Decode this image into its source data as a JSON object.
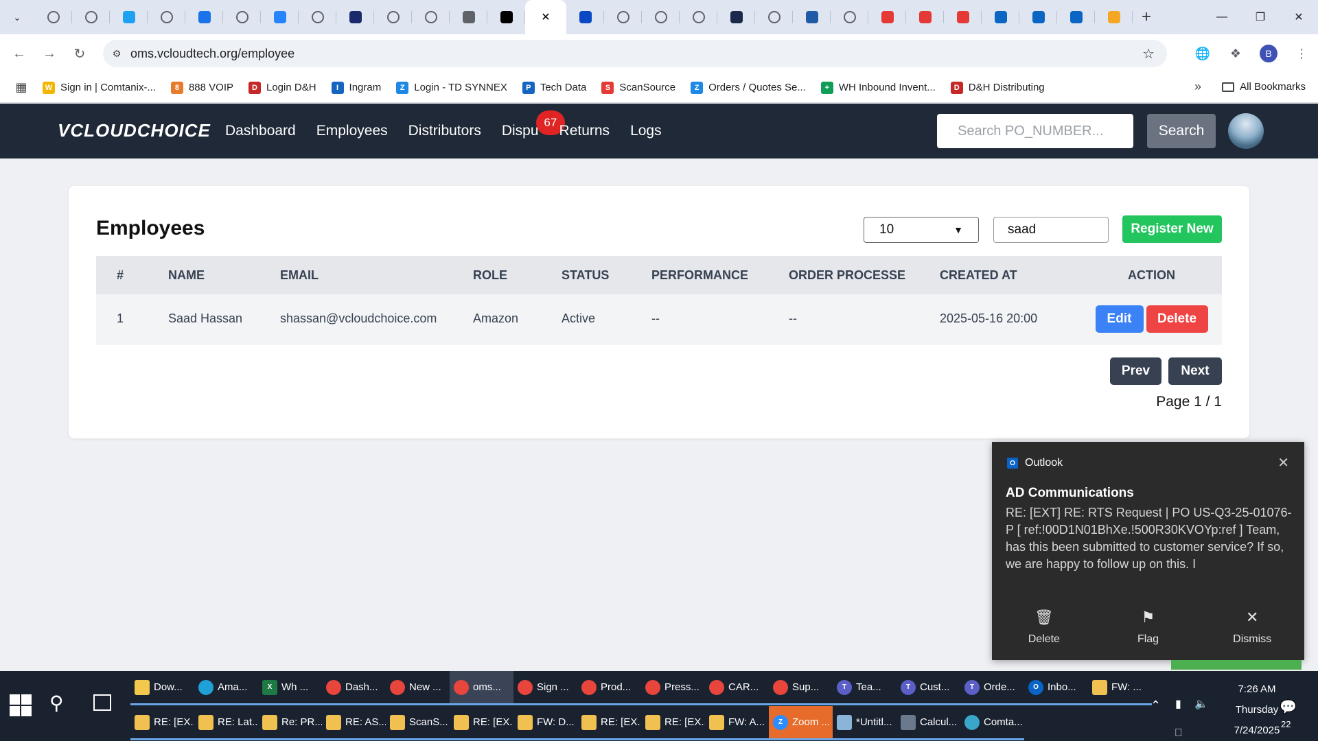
{
  "browser": {
    "tabs": [
      {
        "icon": "globe-icon",
        "color": "#5f6368"
      },
      {
        "icon": "globe-icon",
        "color": "#5f6368"
      },
      {
        "icon": "logi-icon",
        "color": "#1ea1f2"
      },
      {
        "icon": "globe-icon",
        "color": "#5f6368"
      },
      {
        "icon": "chevron-app-icon",
        "color": "#1a73e8"
      },
      {
        "icon": "globe-icon",
        "color": "#5f6368"
      },
      {
        "icon": "jira-icon",
        "color": "#2684ff"
      },
      {
        "icon": "globe-icon",
        "color": "#5f6368"
      },
      {
        "icon": "app-square-icon",
        "color": "#1b2a6b"
      },
      {
        "icon": "globe-icon",
        "color": "#5f6368"
      },
      {
        "icon": "globe-icon",
        "color": "#5f6368"
      },
      {
        "icon": "search-app-icon",
        "color": "#5f6368"
      },
      {
        "icon": "vercel-icon",
        "color": "#000000"
      },
      {
        "icon": "close-icon",
        "color": "#000000"
      },
      {
        "icon": "u-app-icon",
        "color": "#0b48c6"
      },
      {
        "icon": "globe-icon",
        "color": "#5f6368"
      },
      {
        "icon": "globe-icon",
        "color": "#5f6368"
      },
      {
        "icon": "globe-icon",
        "color": "#5f6368"
      },
      {
        "icon": "check-app-icon",
        "color": "#1b2a4a"
      },
      {
        "icon": "globe-icon",
        "color": "#5f6368"
      },
      {
        "icon": "etn-icon",
        "color": "#1f5aa6"
      },
      {
        "icon": "globe-icon",
        "color": "#5f6368"
      },
      {
        "icon": "shield-red-icon",
        "color": "#e53935"
      },
      {
        "icon": "shield-red-icon",
        "color": "#e53935"
      },
      {
        "icon": "shield-red-icon",
        "color": "#e53935"
      },
      {
        "icon": "linkedin-icon",
        "color": "#0a66c2"
      },
      {
        "icon": "linkedin-icon",
        "color": "#0a66c2"
      },
      {
        "icon": "linkedin-icon",
        "color": "#0a66c2"
      },
      {
        "icon": "v-app-icon",
        "color": "#f5a623"
      }
    ],
    "url": "oms.vcloudtech.org/employee",
    "profile_initial": "B",
    "bookmarks": [
      {
        "label": "Sign in | Comtanix-...",
        "icon": "w-bookmark-icon",
        "color": "#f2b705",
        "glyph": "W"
      },
      {
        "label": "888 VOIP",
        "icon": "voip-bookmark-icon",
        "color": "#e57c2b",
        "glyph": "8"
      },
      {
        "label": "Login D&H",
        "icon": "dh-bookmark-icon",
        "color": "#c62828",
        "glyph": "D"
      },
      {
        "label": "Ingram",
        "icon": "ingram-bookmark-icon",
        "color": "#1565c0",
        "glyph": "I"
      },
      {
        "label": "Login - TD SYNNEX",
        "icon": "synnex-bookmark-icon",
        "color": "#1e88e5",
        "glyph": "Z"
      },
      {
        "label": "Tech Data",
        "icon": "techdata-bookmark-icon",
        "color": "#1565c0",
        "glyph": "P"
      },
      {
        "label": "ScanSource",
        "icon": "scansource-bookmark-icon",
        "color": "#e53935",
        "glyph": "S"
      },
      {
        "label": "Orders / Quotes Se...",
        "icon": "orders-bookmark-icon",
        "color": "#1e88e5",
        "glyph": "Z"
      },
      {
        "label": "WH Inbound Invent...",
        "icon": "sheets-bookmark-icon",
        "color": "#0f9d58",
        "glyph": "+"
      },
      {
        "label": "D&H Distributing",
        "icon": "dh2-bookmark-icon",
        "color": "#c62828",
        "glyph": "D"
      }
    ],
    "all_bookmarks": "All Bookmarks"
  },
  "app": {
    "logo": "VCLOUDCHOICE",
    "nav": [
      "Dashboard",
      "Employees",
      "Distributors",
      "Dispu",
      "Returns",
      "Logs"
    ],
    "disputes_badge": "67",
    "search_placeholder": "Search PO_NUMBER...",
    "search_button": "Search"
  },
  "page": {
    "title": "Employees",
    "page_size": "10",
    "filter_value": "saad",
    "register_button": "Register New",
    "columns": [
      "#",
      "NAME",
      "EMAIL",
      "ROLE",
      "STATUS",
      "PERFORMANCE",
      "ORDER PROCESSE",
      "CREATED AT",
      "ACTION"
    ],
    "rows": [
      {
        "num": "1",
        "name": "Saad Hassan",
        "email": "shassan@vcloudchoice.com",
        "role": "Amazon",
        "status": "Active",
        "performance": "--",
        "orders": "--",
        "created": "2025-05-16 20:00",
        "edit": "Edit",
        "delete": "Delete"
      }
    ],
    "prev": "Prev",
    "next": "Next",
    "page_info": "Page 1 / 1"
  },
  "notification": {
    "app": "Outlook",
    "sender": "AD Communications",
    "body": "RE: [EXT] RE: RTS Request | PO US-Q3-25-01076-P [ ref:!00D1N01BhXe.!500R30KVOYp:ref ] Team, has this been submitted to customer service?  If so, we are happy to follow up on this.  I",
    "actions": [
      "Delete",
      "Flag",
      "Dismiss"
    ]
  },
  "taskbar": {
    "row1": [
      {
        "label": "Dow...",
        "icon": "file-explorer-icon",
        "color": "#f2c94c",
        "glyph": ""
      },
      {
        "label": "Ama...",
        "icon": "edge-icon",
        "color": "#1fa0d6",
        "glyph": ""
      },
      {
        "label": "Wh ...",
        "icon": "excel-icon",
        "color": "#1d7a45",
        "glyph": "X"
      },
      {
        "label": "Dash...",
        "icon": "chrome-icon",
        "color": "#e8453c",
        "glyph": ""
      },
      {
        "label": "New ...",
        "icon": "chrome-icon",
        "color": "#e8453c",
        "glyph": ""
      },
      {
        "label": "oms...",
        "icon": "chrome-icon",
        "color": "#e8453c",
        "glyph": ""
      },
      {
        "label": "Sign ...",
        "icon": "chrome-icon",
        "color": "#e8453c",
        "glyph": ""
      },
      {
        "label": "Prod...",
        "icon": "chrome-icon",
        "color": "#e8453c",
        "glyph": ""
      },
      {
        "label": "Press...",
        "icon": "chrome-icon",
        "color": "#e8453c",
        "glyph": ""
      },
      {
        "label": "CAR...",
        "icon": "chrome-icon",
        "color": "#e8453c",
        "glyph": ""
      },
      {
        "label": "Sup...",
        "icon": "chrome-icon",
        "color": "#e8453c",
        "glyph": ""
      },
      {
        "label": "Tea...",
        "icon": "teams-icon",
        "color": "#5b5fc7",
        "glyph": "T"
      },
      {
        "label": "Cust...",
        "icon": "teams-icon",
        "color": "#5b5fc7",
        "glyph": "T"
      },
      {
        "label": "Orde...",
        "icon": "teams-icon",
        "color": "#5b5fc7",
        "glyph": "T"
      },
      {
        "label": "Inbo...",
        "icon": "outlook-icon",
        "color": "#0a64c8",
        "glyph": "O"
      },
      {
        "label": "FW: ...",
        "icon": "mail-icon",
        "color": "#f0c050",
        "glyph": ""
      }
    ],
    "row2": [
      {
        "label": "RE: [EX...",
        "icon": "mail-icon",
        "color": "#f0c050",
        "glyph": ""
      },
      {
        "label": "RE: Lat...",
        "icon": "mail-icon",
        "color": "#f0c050",
        "glyph": ""
      },
      {
        "label": "Re: PR...",
        "icon": "mail-icon",
        "color": "#f0c050",
        "glyph": ""
      },
      {
        "label": "RE: AS...",
        "icon": "mail-icon",
        "color": "#f0c050",
        "glyph": ""
      },
      {
        "label": "ScanS...",
        "icon": "mail-icon",
        "color": "#f0c050",
        "glyph": ""
      },
      {
        "label": "RE: [EX...",
        "icon": "mail-icon",
        "color": "#f0c050",
        "glyph": ""
      },
      {
        "label": "FW: D...",
        "icon": "mail-icon",
        "color": "#f0c050",
        "glyph": ""
      },
      {
        "label": "RE: [EX...",
        "icon": "mail-icon",
        "color": "#f0c050",
        "glyph": ""
      },
      {
        "label": "RE: [EX...",
        "icon": "mail-icon",
        "color": "#f0c050",
        "glyph": ""
      },
      {
        "label": "FW: A...",
        "icon": "mail-icon",
        "color": "#f0c050",
        "glyph": ""
      },
      {
        "label": "Zoom ...",
        "icon": "zoom-icon",
        "color": "#2d8cff",
        "glyph": "Z"
      },
      {
        "label": "*Untitl...",
        "icon": "notepad-icon",
        "color": "#8ab4d8",
        "glyph": ""
      },
      {
        "label": "Calcul...",
        "icon": "calculator-icon",
        "color": "#6a7a8c",
        "glyph": ""
      },
      {
        "label": "Comta...",
        "icon": "app-diamond-icon",
        "color": "#3aa6c9",
        "glyph": ""
      }
    ],
    "time": "7:26 AM",
    "day": "Thursday",
    "date": "7/24/2025",
    "notif_count": "22"
  }
}
